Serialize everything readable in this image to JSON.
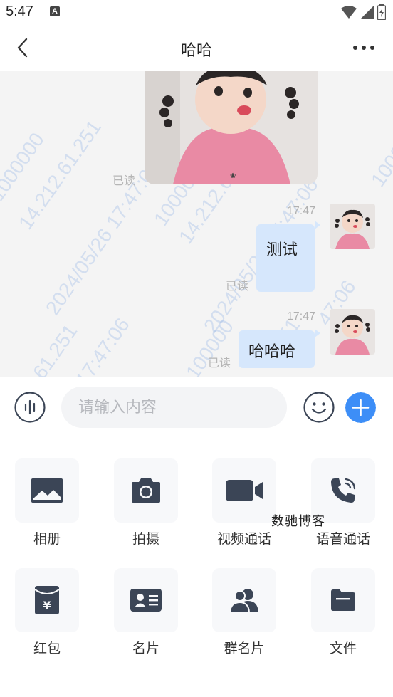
{
  "status_bar": {
    "time": "5:47",
    "notification_icon": "A"
  },
  "header": {
    "title": "哈哈",
    "back_icon": "chevron-left-icon",
    "more_icon": "more-dots-icon"
  },
  "watermarks": [
    "14.212.61.251",
    "2024/05/26 17:47:06",
    "1000000",
    "14.212.61.251",
    "2024/05/26 17:47:06",
    "1000000",
    "61.251",
    "17:47:06",
    "100000",
    "251",
    "47:06",
    "1000"
  ],
  "messages": [
    {
      "type": "image",
      "status": "已读"
    },
    {
      "time": "17:47",
      "text": "测试",
      "status": "已读"
    },
    {
      "time": "17:47",
      "text": "哈哈哈",
      "status": "已读"
    }
  ],
  "input": {
    "placeholder": "请输入内容"
  },
  "tools": [
    {
      "label": "相册",
      "icon": "photo-album-icon"
    },
    {
      "label": "拍摄",
      "icon": "camera-icon"
    },
    {
      "label": "视频通话",
      "icon": "video-call-icon"
    },
    {
      "label": "语音通话",
      "icon": "phone-call-icon"
    },
    {
      "label": "红包",
      "icon": "red-packet-icon"
    },
    {
      "label": "名片",
      "icon": "contact-card-icon"
    },
    {
      "label": "群名片",
      "icon": "group-card-icon"
    },
    {
      "label": "文件",
      "icon": "folder-icon"
    }
  ],
  "overlay_watermark": "数驰博客",
  "colors": {
    "accent": "#3d8ef7",
    "bubble": "#d6e7fc",
    "icon_dark": "#3b4556"
  }
}
